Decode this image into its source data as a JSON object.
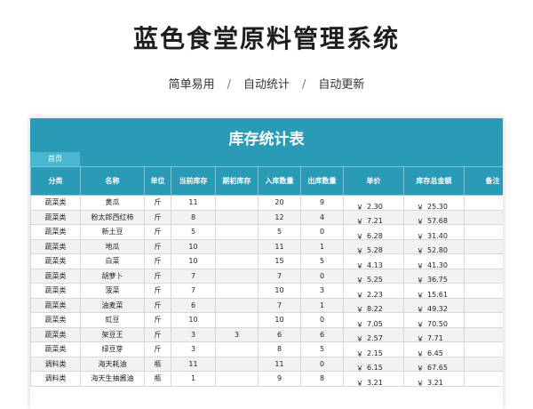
{
  "header": {
    "title": "蓝色食堂原料管理系统",
    "features": [
      "简单易用",
      "自动统计",
      "自动更新"
    ],
    "separator": "/"
  },
  "sheet": {
    "title": "库存统计表",
    "tab_label": "首页",
    "columns": [
      "分类",
      "名称",
      "单位",
      "当前库存",
      "期初库存",
      "入库数量",
      "出库数量",
      "单价",
      "库存总金额",
      "备注"
    ],
    "currency": "￥",
    "rows": [
      {
        "cat": "蔬菜类",
        "name": "黄瓜",
        "unit": "斤",
        "cur": "11",
        "init": "",
        "in": "20",
        "out": "9",
        "price": "2.30",
        "total": "25.30",
        "note": ""
      },
      {
        "cat": "蔬菜类",
        "name": "粉太郎西红柿",
        "unit": "斤",
        "cur": "8",
        "init": "",
        "in": "12",
        "out": "4",
        "price": "7.21",
        "total": "57.68",
        "note": ""
      },
      {
        "cat": "蔬菜类",
        "name": "新土豆",
        "unit": "斤",
        "cur": "5",
        "init": "",
        "in": "5",
        "out": "0",
        "price": "6.28",
        "total": "31.40",
        "note": ""
      },
      {
        "cat": "蔬菜类",
        "name": "地瓜",
        "unit": "斤",
        "cur": "10",
        "init": "",
        "in": "11",
        "out": "1",
        "price": "5.28",
        "total": "52.80",
        "note": ""
      },
      {
        "cat": "蔬菜类",
        "name": "白菜",
        "unit": "斤",
        "cur": "10",
        "init": "",
        "in": "15",
        "out": "5",
        "price": "4.13",
        "total": "41.30",
        "note": ""
      },
      {
        "cat": "蔬菜类",
        "name": "胡萝卜",
        "unit": "斤",
        "cur": "7",
        "init": "",
        "in": "7",
        "out": "0",
        "price": "5.25",
        "total": "36.75",
        "note": ""
      },
      {
        "cat": "蔬菜类",
        "name": "菠菜",
        "unit": "斤",
        "cur": "7",
        "init": "",
        "in": "10",
        "out": "3",
        "price": "2.23",
        "total": "15.61",
        "note": ""
      },
      {
        "cat": "蔬菜类",
        "name": "油麦菜",
        "unit": "斤",
        "cur": "6",
        "init": "",
        "in": "7",
        "out": "1",
        "price": "8.22",
        "total": "49.32",
        "note": ""
      },
      {
        "cat": "蔬菜类",
        "name": "豇豆",
        "unit": "斤",
        "cur": "10",
        "init": "",
        "in": "10",
        "out": "0",
        "price": "7.05",
        "total": "70.50",
        "note": ""
      },
      {
        "cat": "蔬菜类",
        "name": "架豆王",
        "unit": "斤",
        "cur": "3",
        "init": "3",
        "in": "6",
        "out": "6",
        "price": "2.57",
        "total": "7.71",
        "note": ""
      },
      {
        "cat": "蔬菜类",
        "name": "绿豆芽",
        "unit": "斤",
        "cur": "3",
        "init": "",
        "in": "8",
        "out": "5",
        "price": "2.15",
        "total": "6.45",
        "note": ""
      },
      {
        "cat": "调料类",
        "name": "海天耗油",
        "unit": "瓶",
        "cur": "11",
        "init": "",
        "in": "11",
        "out": "0",
        "price": "6.15",
        "total": "67.65",
        "note": ""
      },
      {
        "cat": "调料类",
        "name": "海天生抽酱油",
        "unit": "瓶",
        "cur": "1",
        "init": "",
        "in": "9",
        "out": "8",
        "price": "3.21",
        "total": "3.21",
        "note": ""
      }
    ]
  }
}
